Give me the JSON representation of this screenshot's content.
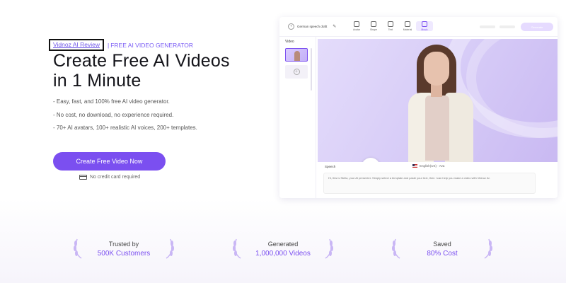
{
  "hero": {
    "review_tag": "Vidnoz AI Review",
    "separator": "|",
    "eyebrow": "FREE AI VIDEO GENERATOR",
    "headline_line1": "Create Free AI Videos",
    "headline_line2": "in 1 Minute",
    "bullets": [
      "- Easy, fast, and 100% free AI video generator.",
      "- No cost, no download, no experience required.",
      "- 70+ AI avatars, 100+ realistic AI voices, 200+ templates."
    ],
    "cta_label": "Create Free Video Now",
    "no_card": "No credit card required"
  },
  "editor": {
    "draft_title": "German speech draft",
    "tools": [
      "Avatar",
      "Shape",
      "Text",
      "Material",
      "Music"
    ],
    "active_tool_index": 4,
    "generate_label": "Generate",
    "scene_label": "Video",
    "speech_label": "Speech",
    "voice_label": "English(US) · Ava",
    "script_text": "Hi, this is Stella, your AI presenter. Simply select a template and paste your text, then I can help you make a video with Vidnoz AI."
  },
  "stats": [
    {
      "label": "Trusted by",
      "value": "500K Customers"
    },
    {
      "label": "Generated",
      "value": "1,000,000 Videos"
    },
    {
      "label": "Saved",
      "value": "80% Cost"
    }
  ],
  "colors": {
    "accent": "#7b4ff0",
    "text": "#14141a"
  }
}
